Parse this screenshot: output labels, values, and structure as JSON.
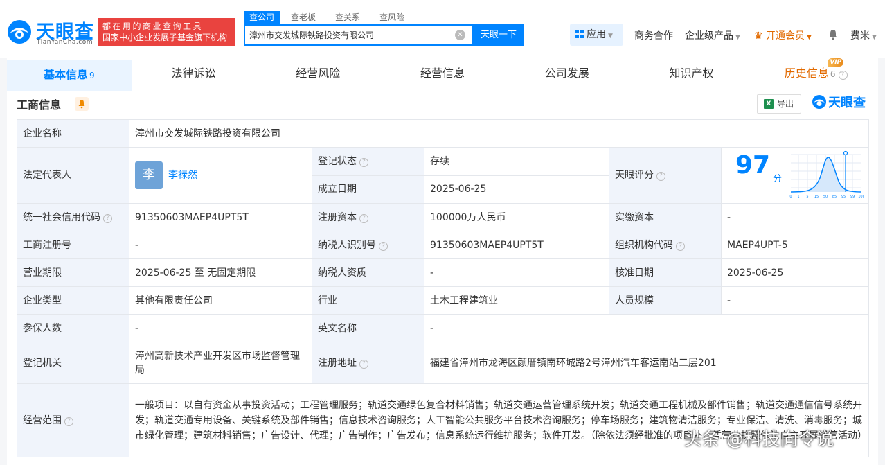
{
  "header": {
    "logo_cn": "天眼查",
    "logo_en": "TianYanCha.com",
    "promo_line1": "都在用的商业查询工具",
    "promo_line2": "国家中小企业发展子基金旗下机构",
    "search_tabs": [
      "查公司",
      "查老板",
      "查关系",
      "查风险"
    ],
    "search_value": "漳州市交发城际铁路投资有限公司",
    "search_button": "天眼一下",
    "apps_label": "应用",
    "business_coop": "商务合作",
    "enterprise_products": "企业级产品",
    "vip_label": "开通会员",
    "user_name": "费米"
  },
  "nav": {
    "tabs": [
      {
        "label": "基本信息",
        "count": "9"
      },
      {
        "label": "法律诉讼",
        "count": ""
      },
      {
        "label": "经营风险",
        "count": ""
      },
      {
        "label": "经营信息",
        "count": ""
      },
      {
        "label": "公司发展",
        "count": ""
      },
      {
        "label": "知识产权",
        "count": ""
      },
      {
        "label": "历史信息",
        "count": "6"
      }
    ],
    "vip_badge": "VIP"
  },
  "section": {
    "title": "工商信息",
    "export_label": "导出",
    "brand": "天眼查"
  },
  "info": {
    "company_name_label": "企业名称",
    "company_name": "漳州市交发城际铁路投资有限公司",
    "legal_rep_label": "法定代表人",
    "legal_rep_avatar": "李",
    "legal_rep": "李禄然",
    "reg_status_label": "登记状态",
    "reg_status": "存续",
    "found_date_label": "成立日期",
    "found_date": "2025-06-25",
    "score_label": "天眼评分",
    "score": "97",
    "score_unit": "分",
    "score_axis": [
      "0",
      "1",
      "5",
      "15",
      "50",
      "85",
      "95",
      "99",
      "100"
    ],
    "credit_code_label": "统一社会信用代码",
    "credit_code": "91350603MAEP4UPT5T",
    "reg_capital_label": "注册资本",
    "reg_capital": "100000万人民币",
    "paid_capital_label": "实缴资本",
    "paid_capital": "-",
    "biz_reg_no_label": "工商注册号",
    "biz_reg_no": "-",
    "taxpayer_id_label": "纳税人识别号",
    "taxpayer_id": "91350603MAEP4UPT5T",
    "org_code_label": "组织机构代码",
    "org_code": "MAEP4UPT-5",
    "term_label": "营业期限",
    "term": "2025-06-25 至 无固定期限",
    "taxpayer_qual_label": "纳税人资质",
    "taxpayer_qual": "-",
    "approve_date_label": "核准日期",
    "approve_date": "2025-06-25",
    "company_type_label": "企业类型",
    "company_type": "其他有限责任公司",
    "industry_label": "行业",
    "industry": "土木工程建筑业",
    "staff_size_label": "人员规模",
    "staff_size": "-",
    "insured_label": "参保人数",
    "insured": "-",
    "english_name_label": "英文名称",
    "english_name": "-",
    "reg_authority_label": "登记机关",
    "reg_authority": "漳州高新技术产业开发区市场监督管理局",
    "reg_address_label": "注册地址",
    "reg_address": "福建省漳州市龙海区颜厝镇南环城路2号漳州汽车客运南站二层201",
    "scope_label": "经营范围",
    "scope": "一般项目：以自有资金从事投资活动；工程管理服务；轨道交通绿色复合材料销售；轨道交通运营管理系统开发；轨道交通工程机械及部件销售；轨道交通通信信号系统开发；轨道交通专用设备、关键系统及部件销售；信息技术咨询服务；人工智能公共服务平台技术咨询服务；停车场服务；建筑物清洁服务；专业保洁、清洗、消毒服务；城市绿化管理；建筑材料销售；广告设计、代理；广告制作；广告发布；信息系统运行维护服务；软件开发。（除依法须经批准的项目外，凭营业执照依法自主开展经营活动）"
  },
  "watermark": "头条 @科技向令说",
  "colors": {
    "brand": "#0084ff",
    "promo": "#e9433f",
    "vip": "#e26a00",
    "active_status": "#2ca85a"
  }
}
